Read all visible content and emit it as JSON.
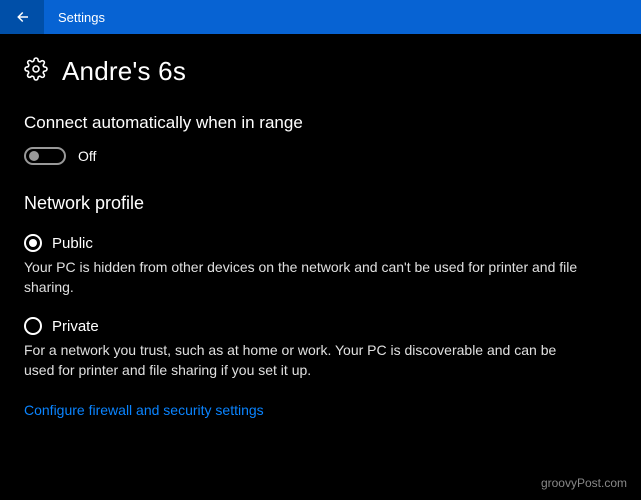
{
  "titlebar": {
    "title": "Settings"
  },
  "page": {
    "title": "Andre's 6s"
  },
  "autoconnect": {
    "label": "Connect automatically when in range",
    "state_label": "Off"
  },
  "network_profile": {
    "heading": "Network profile",
    "options": [
      {
        "label": "Public",
        "description": "Your PC is hidden from other devices on the network and can't be used for printer and file sharing.",
        "selected": true
      },
      {
        "label": "Private",
        "description": "For a network you trust, such as at home or work. Your PC is discoverable and can be used for printer and file sharing if you set it up.",
        "selected": false
      }
    ]
  },
  "link": {
    "label": "Configure firewall and security settings"
  },
  "watermark": "groovyPost.com"
}
